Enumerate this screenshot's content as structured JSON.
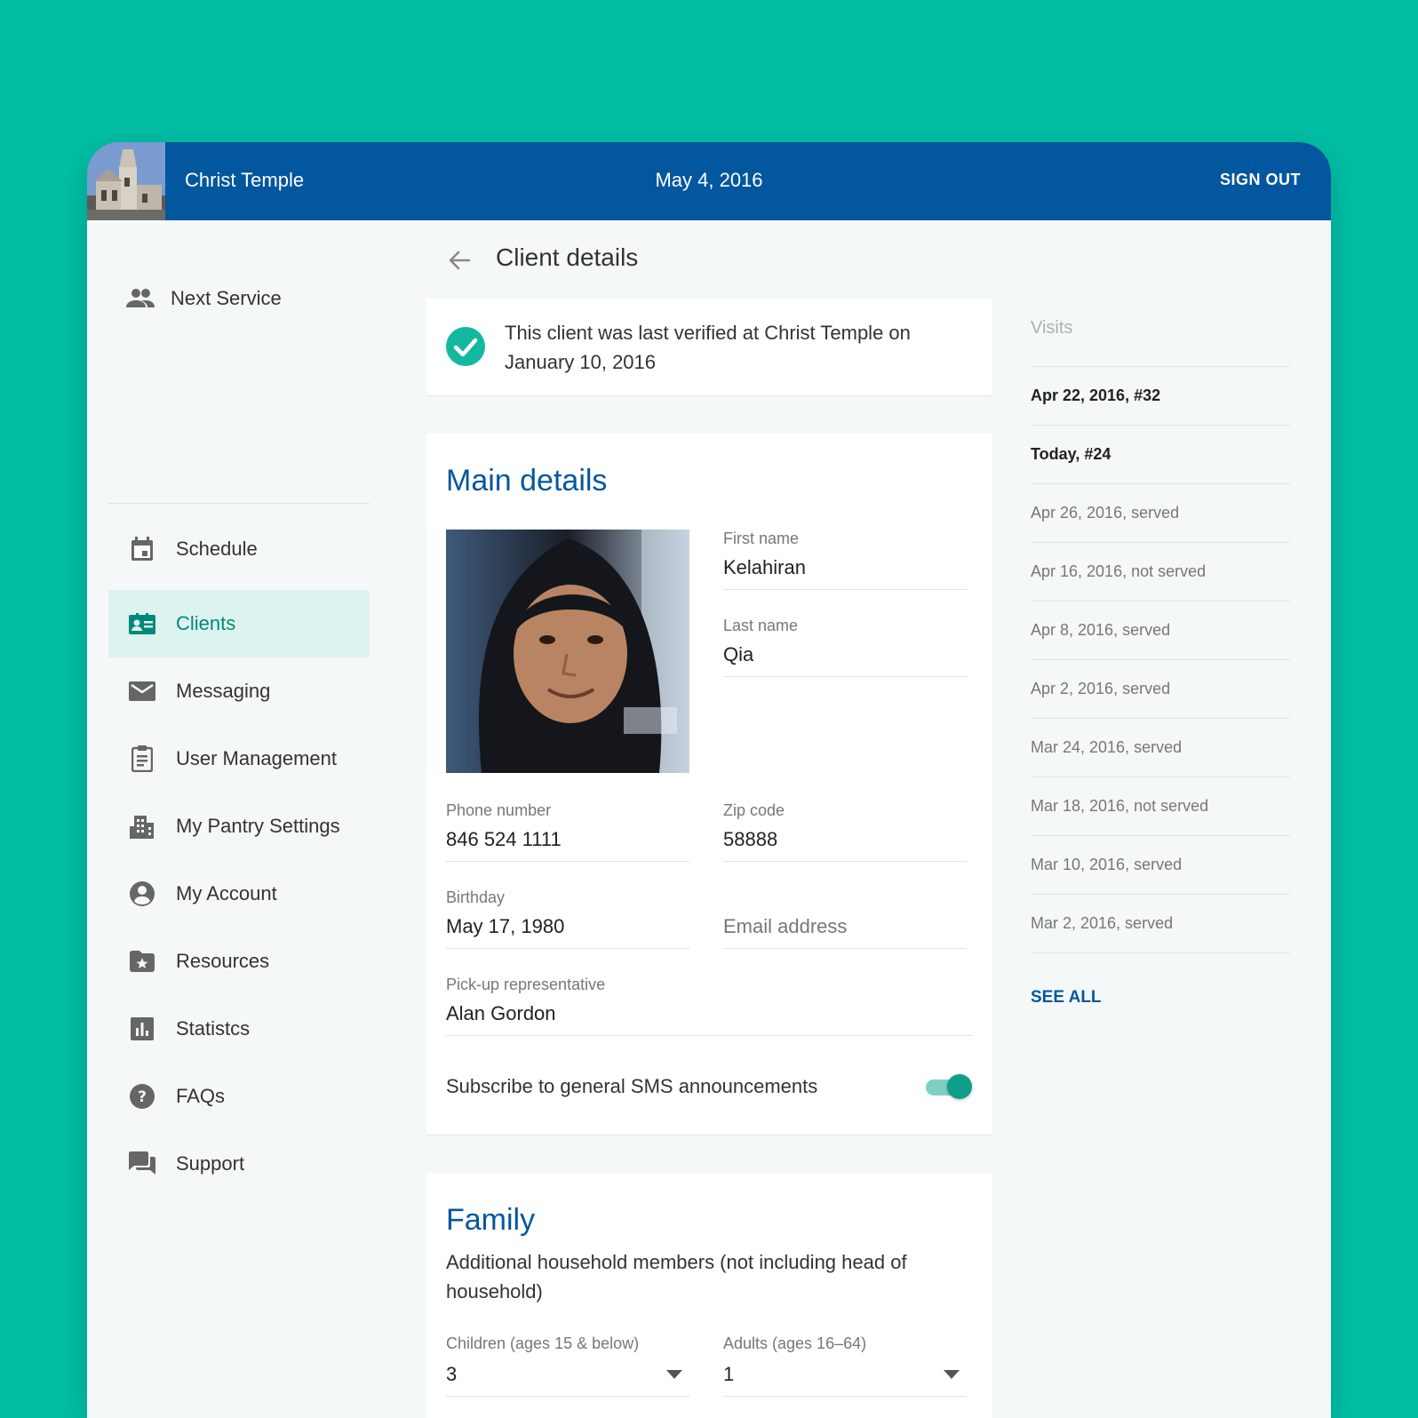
{
  "header": {
    "org_name": "Christ Temple",
    "date": "May 4, 2016",
    "sign_out": "SIGN OUT"
  },
  "sidebar": {
    "items": [
      {
        "label": "Next Service",
        "icon": "people-icon"
      },
      {
        "label": "Schedule",
        "icon": "calendar-icon"
      },
      {
        "label": "Clients",
        "icon": "contact-card-icon",
        "active": true
      },
      {
        "label": "Messaging",
        "icon": "envelope-icon"
      },
      {
        "label": "User Management",
        "icon": "clipboard-icon"
      },
      {
        "label": "My Pantry Settings",
        "icon": "building-icon"
      },
      {
        "label": "My Account",
        "icon": "account-circle-icon"
      },
      {
        "label": "Resources",
        "icon": "folder-star-icon"
      },
      {
        "label": "Statistcs",
        "icon": "bar-chart-icon"
      },
      {
        "label": "FAQs",
        "icon": "help-circle-icon"
      },
      {
        "label": "Support",
        "icon": "chat-icon"
      }
    ]
  },
  "page": {
    "title": "Client details"
  },
  "verification": {
    "text": "This client was last verified at Christ Temple on January 10, 2016"
  },
  "main_details": {
    "title": "Main details",
    "first_name_label": "First name",
    "first_name": "Kelahiran",
    "last_name_label": "Last name",
    "last_name": "Qia",
    "phone_label": "Phone number",
    "phone": "846 524 1111",
    "zip_label": "Zip code",
    "zip": "58888",
    "birthday_label": "Birthday",
    "birthday": "May 17, 1980",
    "email_placeholder": "Email address",
    "pickup_label": "Pick-up representative",
    "pickup": "Alan Gordon",
    "sms_label": "Subscribe to general SMS announcements",
    "sms_enabled": true
  },
  "family": {
    "title": "Family",
    "description": "Additional household members (not including head of household)",
    "children_label": "Children (ages 15 & below)",
    "children_value": "3",
    "adults_label": "Adults (ages 16–64)",
    "adults_value": "1"
  },
  "visits": {
    "title": "Visits",
    "items": [
      {
        "text": "Apr 22, 2016, #32",
        "bold": true
      },
      {
        "text": "Today, #24",
        "bold": true
      },
      {
        "text": "Apr 26, 2016, served",
        "bold": false
      },
      {
        "text": "Apr 16, 2016, not served",
        "bold": false
      },
      {
        "text": "Apr 8, 2016, served",
        "bold": false
      },
      {
        "text": "Apr 2, 2016, served",
        "bold": false
      },
      {
        "text": "Mar 24, 2016, served",
        "bold": false
      },
      {
        "text": "Mar 18, 2016, not served",
        "bold": false
      },
      {
        "text": "Mar 10, 2016, served",
        "bold": false
      },
      {
        "text": "Mar 2, 2016, served",
        "bold": false
      }
    ],
    "see_all": "SEE ALL"
  },
  "colors": {
    "background": "#00bfa5",
    "topbar": "#02579e",
    "accent": "#00897b",
    "section_title": "#02579e"
  }
}
